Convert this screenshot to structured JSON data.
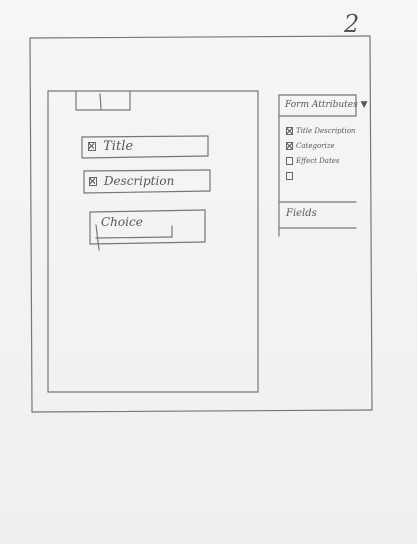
{
  "page_number": "2",
  "form": {
    "fields": [
      {
        "label": "Title",
        "checked": true
      },
      {
        "label": "Description",
        "checked": true
      },
      {
        "label": "Choice",
        "checked": false
      }
    ]
  },
  "sidebar": {
    "dropdown_label": "Form Attributes",
    "attributes": [
      {
        "label": "Title Description",
        "checked": true
      },
      {
        "label": "Categorize",
        "checked": true
      },
      {
        "label": "Effect Dates",
        "checked": false
      },
      {
        "label": "",
        "checked": false
      }
    ],
    "fields_label": "Fields"
  }
}
